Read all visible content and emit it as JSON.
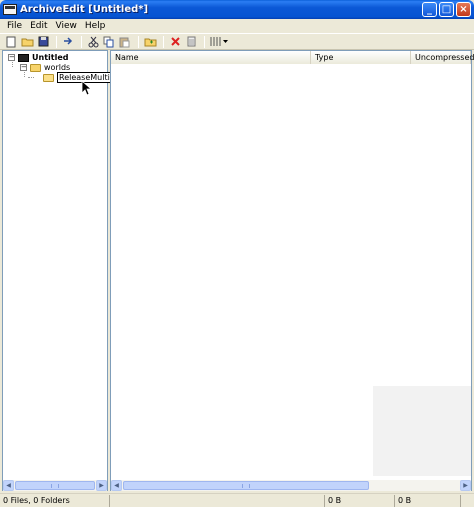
{
  "window": {
    "title": "ArchiveEdit [Untitled*]"
  },
  "menu": {
    "items": [
      "File",
      "Edit",
      "View",
      "Help"
    ]
  },
  "toolbar": {
    "buttons": [
      "new-file",
      "open-folder",
      "save",
      "import",
      "cut",
      "copy",
      "paste",
      "new-folder",
      "delete",
      "properties",
      "columns"
    ]
  },
  "tree": {
    "root_label": "Untitled",
    "child_label": "worlds",
    "rename_value": "ReleaseMultiplayer"
  },
  "list": {
    "columns": [
      "Name",
      "Type",
      "Uncompressed"
    ]
  },
  "status": {
    "summary": "0 Files, 0 Folders",
    "size1": "0 B",
    "size2": "0 B"
  },
  "colors": {
    "titlebar": "#0654d2",
    "chrome": "#ece9d8",
    "border": "#7f9db9"
  }
}
